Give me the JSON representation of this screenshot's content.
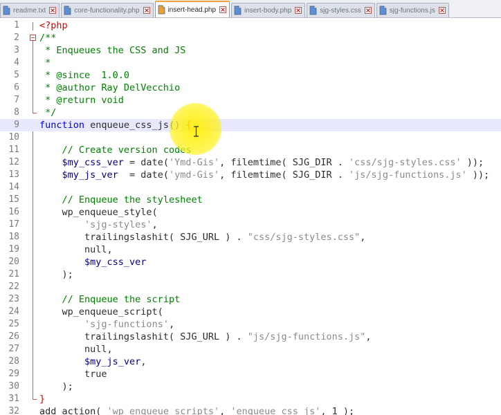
{
  "tabs": [
    {
      "label": "readme.txt",
      "active": false,
      "icon": "file-icon-blue"
    },
    {
      "label": "core-functionality.php",
      "active": false,
      "icon": "file-icon-blue"
    },
    {
      "label": "insert-head.php",
      "active": true,
      "icon": "file-icon-orange"
    },
    {
      "label": "insert-body.php",
      "active": false,
      "icon": "file-icon-blue"
    },
    {
      "label": "sjg-styles.css",
      "active": false,
      "icon": "file-icon-blue"
    },
    {
      "label": "sjg-functions.js",
      "active": false,
      "icon": "file-icon-blue"
    }
  ],
  "editor": {
    "current_line": 9,
    "lines": [
      {
        "n": "1",
        "tokens": [
          [
            "php",
            "<?php"
          ]
        ]
      },
      {
        "n": "2",
        "tokens": [
          [
            "cmt",
            "/**"
          ]
        ]
      },
      {
        "n": "3",
        "tokens": [
          [
            "cmt",
            " * Enqueues the CSS and JS"
          ]
        ]
      },
      {
        "n": "4",
        "tokens": [
          [
            "cmt",
            " *"
          ]
        ]
      },
      {
        "n": "5",
        "tokens": [
          [
            "cmt",
            " * @since  1.0.0"
          ]
        ]
      },
      {
        "n": "6",
        "tokens": [
          [
            "cmt",
            " * @author Ray DelVecchio"
          ]
        ]
      },
      {
        "n": "7",
        "tokens": [
          [
            "cmt",
            " * @return void"
          ]
        ]
      },
      {
        "n": "8",
        "tokens": [
          [
            "cmt",
            " */"
          ]
        ]
      },
      {
        "n": "9",
        "tokens": [
          [
            "kw",
            "function"
          ],
          [
            "txt",
            " enqueue_css_js() "
          ],
          [
            "php",
            "{"
          ]
        ]
      },
      {
        "n": "10",
        "tokens": []
      },
      {
        "n": "11",
        "tokens": [
          [
            "txt",
            "    "
          ],
          [
            "cmt",
            "// Create version codes"
          ]
        ]
      },
      {
        "n": "12",
        "tokens": [
          [
            "txt",
            "    "
          ],
          [
            "var",
            "$my_css_ver"
          ],
          [
            "txt",
            " = date("
          ],
          [
            "str",
            "'Ymd-Gis'"
          ],
          [
            "txt",
            ", filemtime( SJG_DIR . "
          ],
          [
            "str",
            "'css/sjg-styles.css'"
          ],
          [
            "txt",
            " ));"
          ]
        ]
      },
      {
        "n": "13",
        "tokens": [
          [
            "txt",
            "    "
          ],
          [
            "var",
            "$my_js_ver"
          ],
          [
            "txt",
            "  = date("
          ],
          [
            "str",
            "'ymd-Gis'"
          ],
          [
            "txt",
            ", filemtime( SJG_DIR . "
          ],
          [
            "str",
            "'js/sjg-functions.js'"
          ],
          [
            "txt",
            " ));"
          ]
        ]
      },
      {
        "n": "14",
        "tokens": []
      },
      {
        "n": "15",
        "tokens": [
          [
            "txt",
            "    "
          ],
          [
            "cmt",
            "// Enqueue the stylesheet"
          ]
        ]
      },
      {
        "n": "16",
        "tokens": [
          [
            "txt",
            "    wp_enqueue_style("
          ]
        ]
      },
      {
        "n": "17",
        "tokens": [
          [
            "txt",
            "        "
          ],
          [
            "str",
            "'sjg-styles'"
          ],
          [
            "txt",
            ","
          ]
        ]
      },
      {
        "n": "18",
        "tokens": [
          [
            "txt",
            "        trailingslashit( SJG_URL ) . "
          ],
          [
            "str",
            "\"css/sjg-styles.css\""
          ],
          [
            "txt",
            ","
          ]
        ]
      },
      {
        "n": "19",
        "tokens": [
          [
            "txt",
            "        null,"
          ]
        ]
      },
      {
        "n": "20",
        "tokens": [
          [
            "txt",
            "        "
          ],
          [
            "var",
            "$my_css_ver"
          ]
        ]
      },
      {
        "n": "21",
        "tokens": [
          [
            "txt",
            "    );"
          ]
        ]
      },
      {
        "n": "22",
        "tokens": []
      },
      {
        "n": "23",
        "tokens": [
          [
            "txt",
            "    "
          ],
          [
            "cmt",
            "// Enqueue the script"
          ]
        ]
      },
      {
        "n": "24",
        "tokens": [
          [
            "txt",
            "    wp_enqueue_script("
          ]
        ]
      },
      {
        "n": "25",
        "tokens": [
          [
            "txt",
            "        "
          ],
          [
            "str",
            "'sjg-functions'"
          ],
          [
            "txt",
            ","
          ]
        ]
      },
      {
        "n": "26",
        "tokens": [
          [
            "txt",
            "        trailingslashit( SJG_URL ) . "
          ],
          [
            "str",
            "\"js/sjg-functions.js\""
          ],
          [
            "txt",
            ","
          ]
        ]
      },
      {
        "n": "27",
        "tokens": [
          [
            "txt",
            "        null,"
          ]
        ]
      },
      {
        "n": "28",
        "tokens": [
          [
            "txt",
            "        "
          ],
          [
            "var",
            "$my_js_ver"
          ],
          [
            "txt",
            ","
          ]
        ]
      },
      {
        "n": "29",
        "tokens": [
          [
            "txt",
            "        true"
          ]
        ]
      },
      {
        "n": "30",
        "tokens": [
          [
            "txt",
            "    );"
          ]
        ]
      },
      {
        "n": "31",
        "tokens": [
          [
            "php",
            "}"
          ]
        ]
      },
      {
        "n": "32",
        "tokens": [
          [
            "txt",
            "add_action( "
          ],
          [
            "str",
            "'wp_enqueue_scripts'"
          ],
          [
            "txt",
            ", "
          ],
          [
            "str",
            "'enqueue_css_js'"
          ],
          [
            "txt",
            ", 1 );"
          ]
        ]
      }
    ]
  },
  "colors": {
    "keyword": "#0000e6",
    "string": "#8a8a8a",
    "comment": "#008000",
    "variable": "#000080",
    "php_tag": "#e00000",
    "current_line": "#e8e8ff",
    "active_tab_accent": "#f2a33a",
    "cursor_highlight": "#fff000"
  }
}
